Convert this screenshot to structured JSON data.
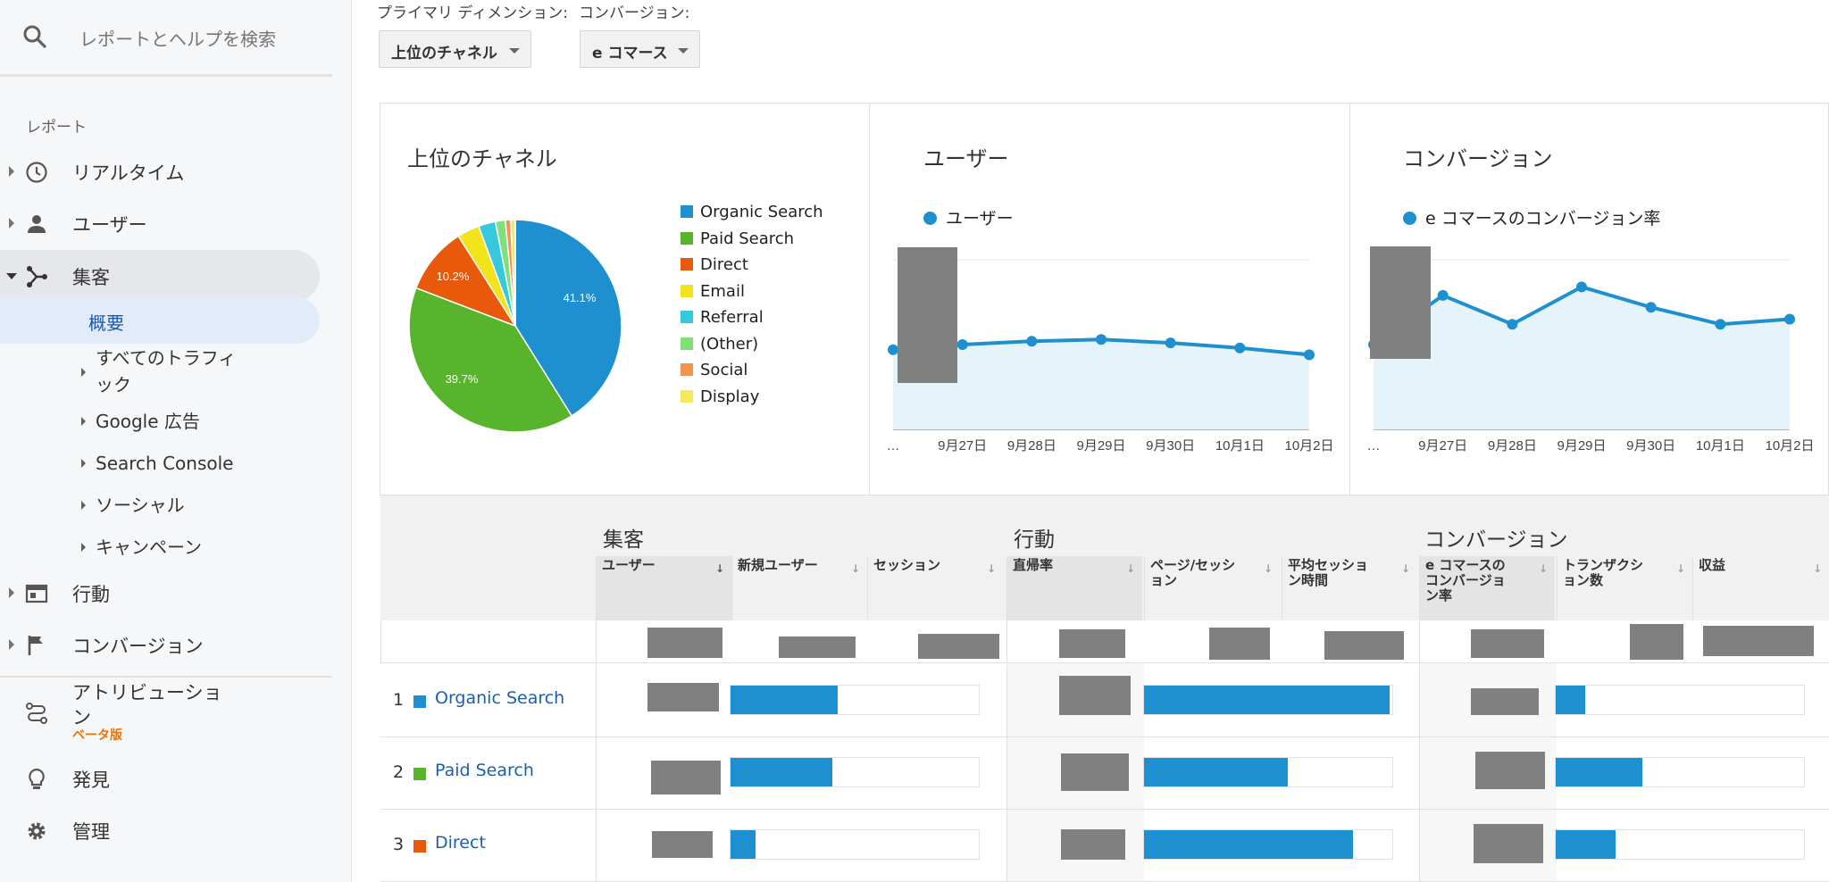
{
  "sidebar": {
    "search_placeholder": "レポートとヘルプを検索",
    "section_label": "レポート",
    "items": {
      "realtime": "リアルタイム",
      "users": "ユーザー",
      "acquisition": "集客",
      "behavior": "行動",
      "conversions": "コンバージョン",
      "attribution_line1": "アトリビューショ",
      "attribution_line2": "ン",
      "attribution_badge": "ベータ版",
      "discover": "発見",
      "admin": "管理"
    },
    "acquisition_sub": {
      "overview": "概要",
      "all_traffic_line1": "すべてのトラフィ",
      "all_traffic_line2": "ック",
      "google_ads": "Google 広告",
      "search_console": "Search Console",
      "social": "ソーシャル",
      "campaigns": "キャンペーン"
    }
  },
  "controls": {
    "primary_dimension_label": "プライマリ ディメンション:",
    "primary_dimension_value": "上位のチャネル",
    "conversion_label": "コンバージョン:",
    "conversion_value": "e コマース"
  },
  "panels": {
    "channels_title": "上位のチャネル",
    "users_title": "ユーザー",
    "conversions_title": "コンバージョン",
    "users_series": "ユーザー",
    "conversions_series": "e コマースのコンバージョン率",
    "legend": [
      {
        "label": "Organic Search",
        "color": "#1e8fcf"
      },
      {
        "label": "Paid Search",
        "color": "#57b42b"
      },
      {
        "label": "Direct",
        "color": "#e8590c"
      },
      {
        "label": "Email",
        "color": "#f2e41a"
      },
      {
        "label": "Referral",
        "color": "#36c9dd"
      },
      {
        "label": "(Other)",
        "color": "#7de07a"
      },
      {
        "label": "Social",
        "color": "#f2944c"
      },
      {
        "label": "Display",
        "color": "#f7ea5a"
      }
    ],
    "pie_labels": {
      "organic": "41.1%",
      "paid": "39.7%",
      "direct": "10.2%"
    },
    "x_ticks": [
      "…",
      "9月27日",
      "9月28日",
      "9月29日",
      "9月30日",
      "10月1日",
      "10月2日"
    ]
  },
  "chart_data": [
    {
      "type": "pie",
      "title": "上位のチャネル",
      "categories": [
        "Organic Search",
        "Paid Search",
        "Direct",
        "Email",
        "Referral",
        "(Other)",
        "Social",
        "Display"
      ],
      "values": [
        41.1,
        39.7,
        10.2,
        3.4,
        2.6,
        1.5,
        0.8,
        0.7
      ]
    },
    {
      "type": "area",
      "title": "ユーザー",
      "x": [
        "…",
        "9月27日",
        "9月28日",
        "9月29日",
        "9月30日",
        "10月1日",
        "10月2日"
      ],
      "series": [
        {
          "name": "ユーザー",
          "values": [
            0.47,
            0.5,
            0.52,
            0.53,
            0.51,
            0.48,
            0.44
          ]
        }
      ],
      "ylim": [
        0,
        1
      ]
    },
    {
      "type": "area",
      "title": "コンバージョン",
      "x": [
        "…",
        "9月27日",
        "9月28日",
        "9月29日",
        "9月30日",
        "10月1日",
        "10月2日"
      ],
      "series": [
        {
          "name": "e コマースのコンバージョン率",
          "values": [
            0.5,
            0.79,
            0.62,
            0.84,
            0.72,
            0.62,
            0.65
          ]
        }
      ],
      "ylim": [
        0,
        1
      ]
    }
  ],
  "table": {
    "groups": {
      "acquisition": "集客",
      "behavior": "行動",
      "conversions": "コンバージョン"
    },
    "columns": {
      "users": "ユーザー",
      "new_users": "新規ユーザー",
      "sessions": "セッション",
      "bounce_rate": "直帰率",
      "pages_per_session_1": "ページ/セッシ",
      "pages_per_session_2": "ョン",
      "avg_session_1": "平均セッショ",
      "avg_session_2": "ン時間",
      "ecommerce_rate_1": "e コマースの",
      "ecommerce_rate_2": "コンバージョ",
      "ecommerce_rate_3": "ン率",
      "transactions_1": "トランザクシ",
      "transactions_2": "ョン数",
      "revenue": "収益"
    },
    "rows": [
      {
        "rank": "1",
        "channel": "Organic Search",
        "color": "#1e8fcf",
        "new_users_share": 0.43,
        "pages_share": 0.99,
        "transactions_share": 0.12
      },
      {
        "rank": "2",
        "channel": "Paid Search",
        "color": "#57b42b",
        "new_users_share": 0.41,
        "pages_share": 0.58,
        "transactions_share": 0.35
      },
      {
        "rank": "3",
        "channel": "Direct",
        "color": "#e8590c",
        "new_users_share": 0.1,
        "pages_share": 0.84,
        "transactions_share": 0.24
      }
    ]
  }
}
